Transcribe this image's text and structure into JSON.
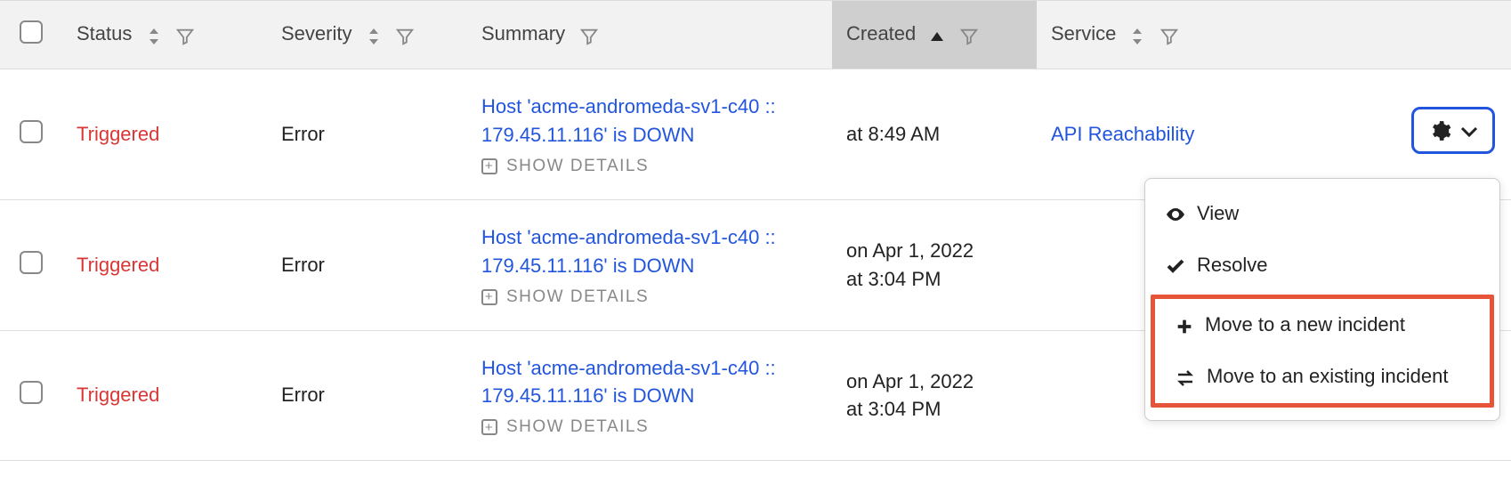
{
  "columns": {
    "status": "Status",
    "severity": "Severity",
    "summary": "Summary",
    "created": "Created",
    "service": "Service"
  },
  "show_details_label": "SHOW DETAILS",
  "rows": [
    {
      "status": "Triggered",
      "severity": "Error",
      "summary": "Host 'acme-andromeda-sv1-c40 :: 179.45.11.116' is DOWN",
      "created_line1": "at 8:49 AM",
      "created_line2": "",
      "service": "API Reachability"
    },
    {
      "status": "Triggered",
      "severity": "Error",
      "summary": "Host 'acme-andromeda-sv1-c40 :: 179.45.11.116' is DOWN",
      "created_line1": "on Apr 1, 2022",
      "created_line2": "at 3:04 PM",
      "service": ""
    },
    {
      "status": "Triggered",
      "severity": "Error",
      "summary": "Host 'acme-andromeda-sv1-c40 :: 179.45.11.116' is DOWN",
      "created_line1": "on Apr 1, 2022",
      "created_line2": "at 3:04 PM",
      "service": ""
    }
  ],
  "menu": {
    "view": "View",
    "resolve": "Resolve",
    "move_new": "Move to a new incident",
    "move_existing": "Move to an existing incident"
  }
}
